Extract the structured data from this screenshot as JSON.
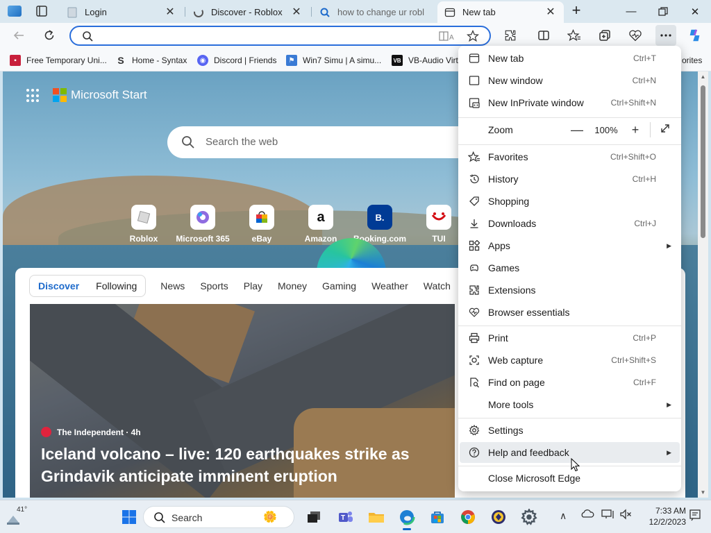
{
  "tabs": [
    {
      "title": "Login"
    },
    {
      "title": "Discover - Roblox"
    },
    {
      "title": "how to change ur robl"
    },
    {
      "title": "New tab"
    }
  ],
  "address": {
    "value": "",
    "placeholder": ""
  },
  "favorites": [
    {
      "label": "Free Temporary Uni..."
    },
    {
      "label": "Home - Syntax"
    },
    {
      "label": "Discord | Friends"
    },
    {
      "label": "Win7 Simu | A simu..."
    },
    {
      "label": "VB-Audio Virt"
    },
    {
      "label": "orites"
    }
  ],
  "content": {
    "brand": "Microsoft Start",
    "search_placeholder": "Search the web",
    "quick_links": [
      {
        "label": "Roblox"
      },
      {
        "label": "Microsoft 365"
      },
      {
        "label": "eBay"
      },
      {
        "label": "Amazon",
        "icon_text": "a"
      },
      {
        "label": "Booking.com",
        "icon_text": "B."
      },
      {
        "label": "TUI"
      }
    ],
    "feed_pills": {
      "discover": "Discover",
      "following": "Following"
    },
    "feed_tabs": [
      "News",
      "Sports",
      "Play",
      "Money",
      "Gaming",
      "Weather",
      "Watch"
    ],
    "article": {
      "source": "The Independent · 4h",
      "headline": "Iceland volcano – live: 120 earthquakes strike as Grindavik anticipate imminent eruption"
    }
  },
  "menu": {
    "new_tab": {
      "label": "New tab",
      "shortcut": "Ctrl+T"
    },
    "new_window": {
      "label": "New window",
      "shortcut": "Ctrl+N"
    },
    "new_inprivate": {
      "label": "New InPrivate window",
      "shortcut": "Ctrl+Shift+N"
    },
    "zoom": {
      "label": "Zoom",
      "value": "100%",
      "minus": "—",
      "plus": "+"
    },
    "favorites": {
      "label": "Favorites",
      "shortcut": "Ctrl+Shift+O"
    },
    "history": {
      "label": "History",
      "shortcut": "Ctrl+H"
    },
    "shopping": {
      "label": "Shopping"
    },
    "downloads": {
      "label": "Downloads",
      "shortcut": "Ctrl+J"
    },
    "apps": {
      "label": "Apps"
    },
    "games": {
      "label": "Games"
    },
    "extensions": {
      "label": "Extensions"
    },
    "browser_essentials": {
      "label": "Browser essentials"
    },
    "print": {
      "label": "Print",
      "shortcut": "Ctrl+P"
    },
    "web_capture": {
      "label": "Web capture",
      "shortcut": "Ctrl+Shift+S"
    },
    "find_on_page": {
      "label": "Find on page",
      "shortcut": "Ctrl+F"
    },
    "more_tools": {
      "label": "More tools"
    },
    "settings": {
      "label": "Settings"
    },
    "help": {
      "label": "Help and feedback"
    },
    "close_edge": {
      "label": "Close Microsoft Edge"
    }
  },
  "taskbar": {
    "weather_temp": "41°",
    "search_label": "Search",
    "time": "7:33 AM",
    "date": "12/2/2023"
  },
  "colors": {
    "accent": "#2a6edb",
    "tabstrip": "#dbe8f0",
    "toolbar": "#f7f9fb",
    "menu_highlight": "#e9ecef"
  }
}
